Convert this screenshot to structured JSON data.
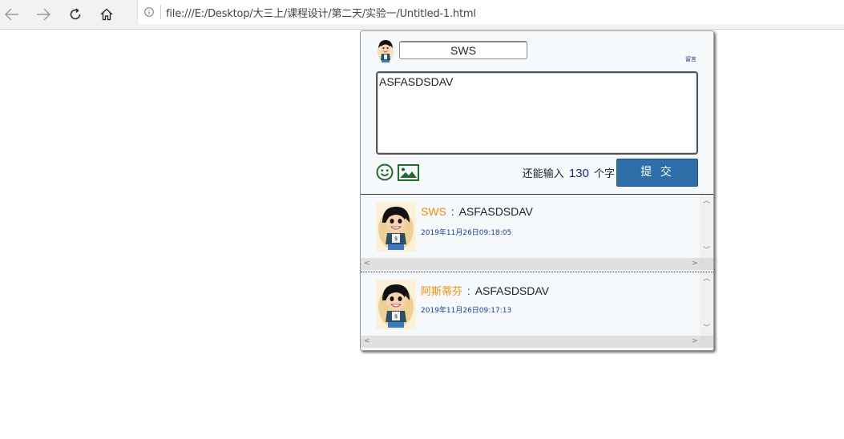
{
  "browser": {
    "url": "file:///E:/Desktop/大三上/课程设计/第二天/实验一/Untitled-1.html",
    "back_icon": "arrow-left-icon",
    "forward_icon": "arrow-right-icon",
    "refresh_icon": "refresh-icon",
    "home_icon": "home-icon",
    "info_icon": "info-icon"
  },
  "compose": {
    "username_value": "SWS",
    "small_link": "留言",
    "message_value": "ASFASDSDAV",
    "counter_prefix": "还能输入",
    "counter_remaining": "130",
    "counter_suffix": "个字",
    "submit_label": "提 交",
    "emoji_icon": "smiley-icon",
    "image_icon": "image-icon",
    "submit_color": "#2e6fa9"
  },
  "messages": [
    {
      "author": "SWS",
      "separator": " : ",
      "text": "ASFASDSDAV",
      "time": "2019年11月26日09:18:05"
    },
    {
      "author": "阿斯蒂芬",
      "separator": " : ",
      "text": "ASFASDSDAV",
      "time": "2019年11月26日09:17:13"
    }
  ],
  "colors": {
    "author": "#f08c0a",
    "time": "#1a3c8c",
    "counter_number": "#1a2a7a"
  }
}
